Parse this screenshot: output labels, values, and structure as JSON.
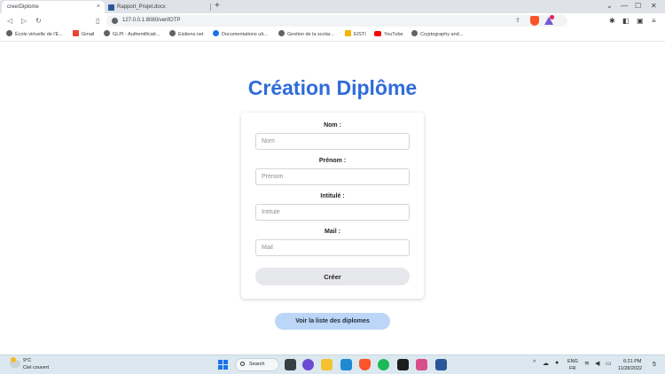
{
  "browser": {
    "tabs": [
      {
        "title": "creerDiplome",
        "active": true
      },
      {
        "title": "Rapport_Projet.docx",
        "active": false
      }
    ],
    "new_tab_symbol": "+",
    "close_symbol": "×",
    "address_bar": {
      "url": "127.0.0.1:8080/verifOTP"
    },
    "bookmarks": [
      {
        "label": "École virtuelle de l'E...",
        "icon": "globe-icon"
      },
      {
        "label": "Gmail",
        "icon": "gmail-icon"
      },
      {
        "label": "GLPI - Authentificati...",
        "icon": "glpi-icon"
      },
      {
        "label": "Eistiens.net",
        "icon": "globe-icon"
      },
      {
        "label": "Documentations uti...",
        "icon": "globe-icon"
      },
      {
        "label": "Gestion de la scolar...",
        "icon": "globe-icon"
      },
      {
        "label": "EISTI",
        "icon": "folder-icon"
      },
      {
        "label": "YouTube",
        "icon": "youtube-icon"
      },
      {
        "label": "Cryptography and...",
        "icon": "globe-icon"
      }
    ]
  },
  "page": {
    "title": "Création Diplôme",
    "form": {
      "fields": [
        {
          "label": "Nom :",
          "placeholder": "Nom",
          "value": ""
        },
        {
          "label": "Prénom :",
          "placeholder": "Prenom",
          "value": ""
        },
        {
          "label": "Intitulé :",
          "placeholder": "Intitulé",
          "value": ""
        },
        {
          "label": "Mail :",
          "placeholder": "Mail",
          "value": ""
        }
      ],
      "submit_label": "Créer"
    },
    "list_button_label": "Voir la liste des diplomes"
  },
  "taskbar": {
    "weather": {
      "temp": "9°C",
      "description": "Ciel couvert"
    },
    "search_label": "Search",
    "language": {
      "code": "ENG",
      "region": "FR"
    },
    "clock": {
      "time": "6:21 PM",
      "date": "11/28/2022"
    },
    "notification_count": "5"
  },
  "colors": {
    "title_blue": "#2f6bdc",
    "list_button_bg": "#bcd6f7",
    "create_button_bg": "#e6e7ea"
  }
}
